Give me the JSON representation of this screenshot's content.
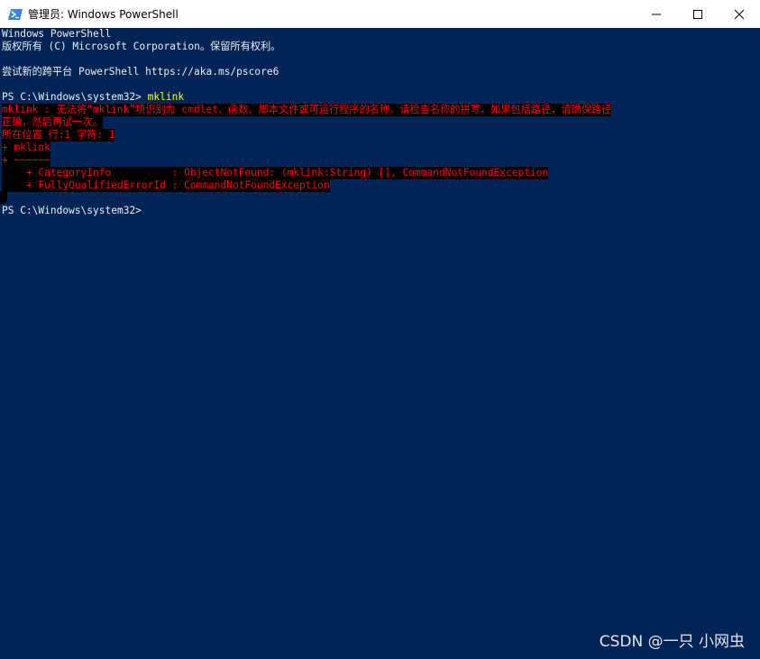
{
  "window": {
    "title": "管理员: Windows PowerShell",
    "icon": "powershell-icon",
    "controls": [
      "minimize-icon",
      "maximize-icon",
      "close-icon"
    ]
  },
  "colors": {
    "console_bg": "#012456",
    "text": "#EEEDF0",
    "error_fg": "#FF0000",
    "error_bg": "#000000",
    "command": "#FFFF00"
  },
  "console": {
    "banner_line1": "Windows PowerShell",
    "banner_line2": "版权所有 (C) Microsoft Corporation。保留所有权利。",
    "banner_line3": "尝试新的跨平台 PowerShell https://aka.ms/pscore6",
    "prompt1": "PS C:\\Windows\\system32> ",
    "command1": "mklink",
    "error_lines": [
      "mklink : 无法将“mklink”项识别为 cmdlet、函数、脚本文件或可运行程序的名称。请检查名称的拼写，如果包括路径，请确保路径",
      "正确，然后再试一次。",
      "所在位置 行:1 字符: 1",
      "+ mklink",
      "+ ~~~~~~",
      "    + CategoryInfo          : ObjectNotFound: (mklink:String) [], CommandNotFoundException",
      "    + FullyQualifiedErrorId : CommandNotFoundException"
    ],
    "prompt2": "PS C:\\Windows\\system32>"
  },
  "watermark": "CSDN @一只 小网虫"
}
